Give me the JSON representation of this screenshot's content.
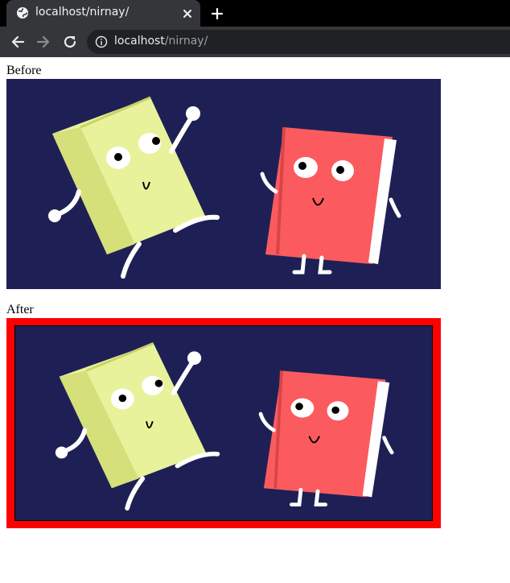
{
  "browser": {
    "tab_title": "localhost/nirnay/",
    "address_host": "localhost",
    "address_path": "/nirnay/",
    "icons": {
      "favicon": "globe-icon",
      "close": "close-icon",
      "new_tab": "plus-icon",
      "back": "back-arrow-icon",
      "forward": "forward-arrow-icon",
      "reload": "reload-icon",
      "site_info": "info-icon"
    }
  },
  "page": {
    "before_label": "Before",
    "after_label": "After",
    "after_border_color": "#ff0000",
    "illustration_bg": "#1e2055",
    "green_book_color": "#e8f29a",
    "red_book_color": "#fb5b5e"
  }
}
